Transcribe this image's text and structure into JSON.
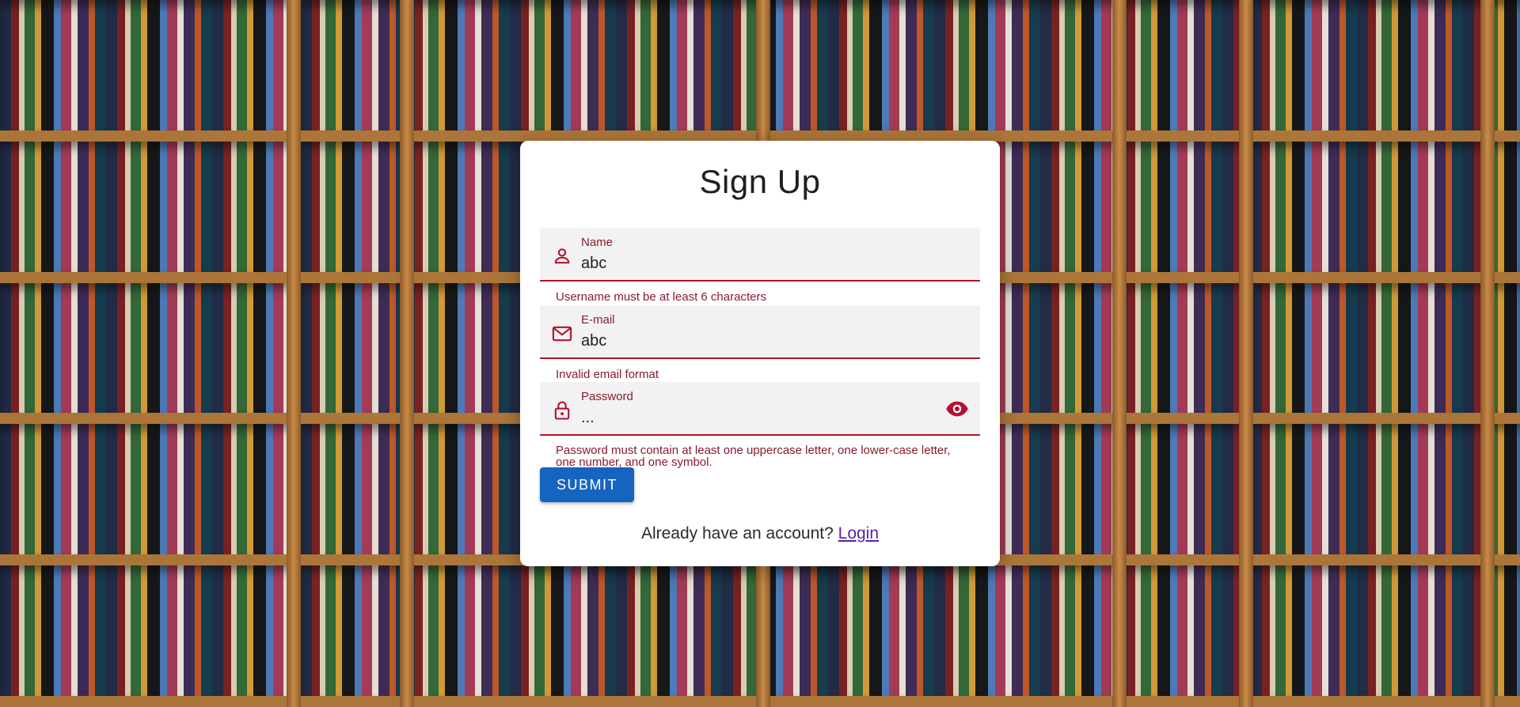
{
  "form": {
    "title": "Sign Up",
    "fields": {
      "name": {
        "label": "Name",
        "value": "abc",
        "icon": "person-icon",
        "error": "Username must be at least 6 characters"
      },
      "email": {
        "label": "E-mail",
        "value": "abc",
        "icon": "mail-icon",
        "error": "Invalid email format"
      },
      "password": {
        "label": "Password",
        "value": "...",
        "icon": "lock-icon",
        "toggle_icon": "eye-icon",
        "error": "Password must contain at least one uppercase letter, one lower-case letter, one number, and one symbol."
      }
    },
    "submit_label": "SUBMIT",
    "login_prompt": "Already have an account?",
    "login_link": "Login"
  },
  "colors": {
    "accent": "#b3122e",
    "error_text": "#8b1a2e",
    "button": "#1565c0",
    "link": "#5b1fa8"
  }
}
